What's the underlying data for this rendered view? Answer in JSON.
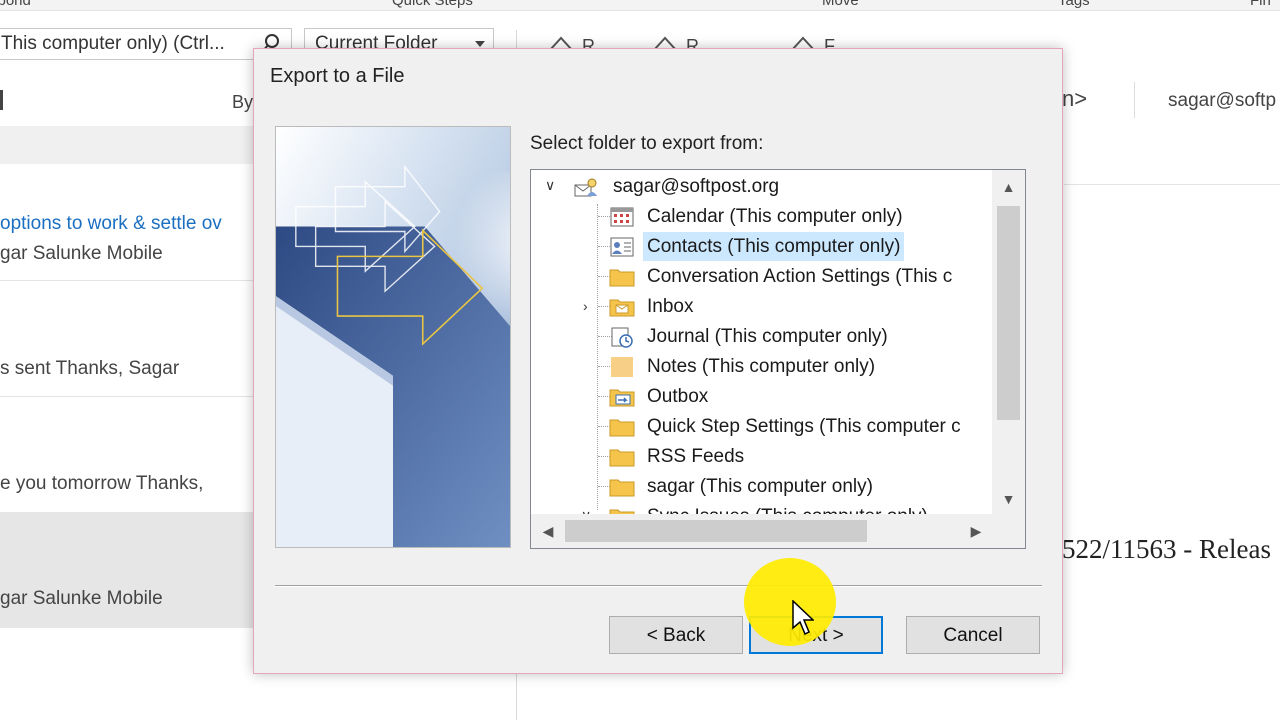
{
  "background": {
    "ribbon_groups": [
      "spond",
      "Quick Steps",
      "Move",
      "Tags",
      "Fin"
    ],
    "search_placeholder": "This computer only) (Ctrl...",
    "search_scope": "Current Folder",
    "sort_label": "By",
    "mail_items": [
      {
        "subject": "options to work & settle ov",
        "from": "gar Salunke  Mobile"
      },
      {
        "preview": "s sent   Thanks,  Sagar"
      },
      {
        "preview": "e you tomorrow  Thanks,"
      },
      {
        "from": "gar Salunke  Mobile"
      }
    ],
    "reply_actions": [
      "R",
      "R",
      "F"
    ],
    "to_fragment": "n>",
    "to_email": "sagar@softp",
    "body_fragment": "522/11563 - Releas"
  },
  "dialog": {
    "title": "Export to a File",
    "select_label": "Select folder to export from:",
    "tree": {
      "root": "sagar@softpost.org",
      "items": [
        {
          "label": "Calendar (This computer only)",
          "icon": "calendar-icon"
        },
        {
          "label": "Contacts (This computer only)",
          "icon": "contacts-icon",
          "selected": true
        },
        {
          "label": "Conversation Action Settings (This c",
          "icon": "folder-icon"
        },
        {
          "label": "Inbox",
          "icon": "inbox-icon",
          "expandable": true
        },
        {
          "label": "Journal (This computer only)",
          "icon": "journal-icon"
        },
        {
          "label": "Notes (This computer only)",
          "icon": "notes-icon"
        },
        {
          "label": "Outbox",
          "icon": "outbox-icon"
        },
        {
          "label": "Quick Step Settings (This computer c",
          "icon": "folder-icon"
        },
        {
          "label": "RSS Feeds",
          "icon": "folder-icon"
        },
        {
          "label": "sagar (This computer only)",
          "icon": "folder-icon"
        },
        {
          "label": "Sync Issues (This computer only)",
          "icon": "folder-icon",
          "expandable": true
        }
      ]
    },
    "buttons": {
      "back": "< Back",
      "next": "Next >",
      "cancel": "Cancel"
    }
  },
  "colors": {
    "selection": "#cce8ff",
    "default_button_border": "#0078d7",
    "link_blue": "#1b6fc1",
    "highlight": "#ffec00"
  }
}
